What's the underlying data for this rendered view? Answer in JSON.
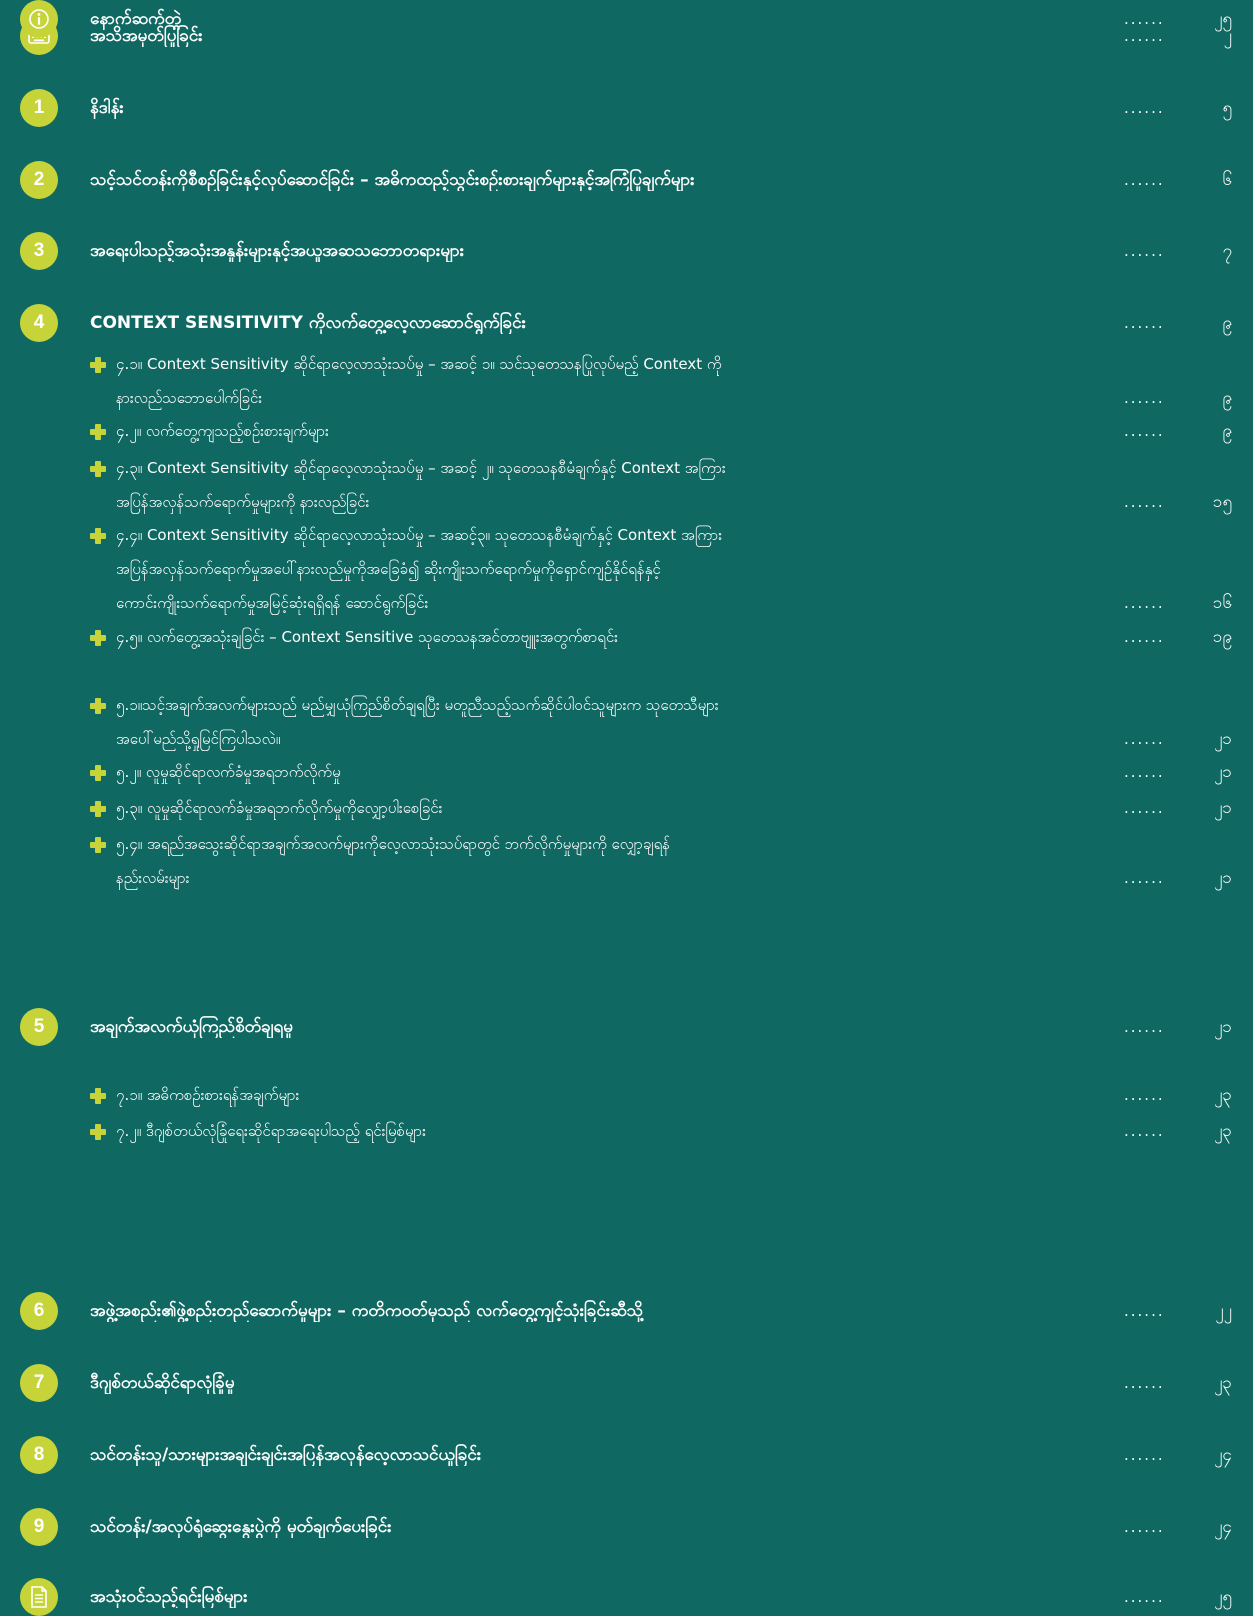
{
  "toc": {
    "entries": [
      {
        "badge": "keyboard-icon",
        "title": "အသိအမှတ်ပြုခြင်း",
        "dots": "......",
        "page": "၂",
        "subs": []
      },
      {
        "badge": "1",
        "title": "နိဒါန်း",
        "dots": "......",
        "page": "၅",
        "subs": []
      },
      {
        "badge": "2",
        "title": "သင့်သင်တန်းကိုစီစဉ်ခြင်းနှင့်လုပ်ဆောင်ခြင်း – အဓိကထည့်သွင်းစဉ်းစားချက်များနှင့်အကြံပြုချက်များ",
        "dots": "......",
        "page": "၆",
        "subs": []
      },
      {
        "badge": "3",
        "title": "အရေးပါသည့်အသုံးအနှုန်းများနှင့်အယူအဆသဘောတရားများ",
        "dots": "......",
        "page": "၇",
        "subs": []
      },
      {
        "badge": "4",
        "title": "CONTEXT SENSITIVITY ကိုလက်တွေ့လေ့လာဆောင်ရွက်ခြင်း",
        "dots": "......",
        "page": "၉",
        "subs": [
          {
            "lines": [
              "၄.၁။ Context Sensitivity ဆိုင်ရာလေ့လာသုံးသပ်မှု – အဆင့် ၁။ သင်သုတေသနပြုလုပ်မည့် Context ကို",
              "နားလည်သဘောပေါက်ခြင်း"
            ],
            "dots": "......",
            "page": "၉"
          },
          {
            "lines": [
              "၄.၂။ လက်တွေ့ကျသည့်စဉ်းစားချက်များ"
            ],
            "dots": "......",
            "page": "၉"
          },
          {
            "lines": [
              "၄.၃။ Context Sensitivity ဆိုင်ရာလေ့လာသုံးသပ်မှု – အဆင့် ၂။ သုတေသနစီမံချက်နှင့် Context အကြား",
              "အပြန်အလှန်သက်ရောက်မှုများကို နားလည်ခြင်း"
            ],
            "dots": "......",
            "page": "၁၅"
          },
          {
            "lines": [
              "၄.၄။ Context Sensitivity ဆိုင်ရာလေ့လာသုံးသပ်မှု – အဆင့်၃။ သုတေသနစီမံချက်နှင့် Context အကြား",
              "အပြန်အလှန်သက်ရောက်မှုအပေါ်နားလည်မှုကိုအခြေခံ၍ ဆိုးကျိုးသက်ရောက်မှုကိုရှောင်ကျဉ်နိုင်ရန်နှင့်",
              "ကောင်းကျိုးသက်ရောက်မှုအမြင့်ဆုံးရရှိရန် ဆောင်ရွက်ခြင်း"
            ],
            "dots": "......",
            "page": "၁၆"
          },
          {
            "lines": [
              "၄.၅။ လက်တွေ့အသုံးချခြင်း – Context Sensitive သုတေသနအင်တာဗျူးအတွက်စာရင်း"
            ],
            "dots": "......",
            "page": "၁၉"
          }
        ]
      },
      {
        "badge": "5",
        "title": "အချက်အလက်ယုံကြည်စိတ်ချရမှု",
        "dots": "......",
        "page": "၂၁",
        "subs": [
          {
            "lines": [
              "၅.၁။သင့်အချက်အလက်များသည် မည်မျှယုံကြည်စိတ်ချရပြီး မတူညီသည့်သက်ဆိုင်ပါဝင်သူများက သုတေသီများ",
              "အပေါ်မည်သို့ရှုမြင်ကြပါသလဲ။"
            ],
            "dots": "......",
            "page": "၂၁"
          },
          {
            "lines": [
              "၅.၂။ လူမှုဆိုင်ရာလက်ခံမှုအရဘက်လိုက်မှု"
            ],
            "dots": "......",
            "page": "၂၁"
          },
          {
            "lines": [
              "၅.၃။ လူမှုဆိုင်ရာလက်ခံမှုအရဘက်လိုက်မှုကိုလျှော့ပါးစေခြင်း"
            ],
            "dots": "......",
            "page": "၂၁"
          },
          {
            "lines": [
              "၅.၄။ အရည်အသွေးဆိုင်ရာအချက်အလက်များကိုလေ့လာသုံးသပ်ရာတွင် ဘက်လိုက်မှုများကို လျှော့ချရန်",
              "နည်းလမ်းများ"
            ],
            "dots": "......",
            "page": "၂၁"
          }
        ]
      },
      {
        "badge": "6",
        "title": "အဖွဲ့အစည်း၏ဖွဲ့စည်းတည်ဆောက်မှုများ – ကတိကဝတ်မှသည် လက်တွေ့ကျင့်သုံးခြင်းဆီသို့",
        "dots": "......",
        "page": "၂၂",
        "subs": []
      },
      {
        "badge": "7",
        "title": "ဒီဂျစ်တယ်ဆိုင်ရာလုံခြုံမှု",
        "dots": "......",
        "page": "၂၃",
        "subs": [
          {
            "lines": [
              "၇.၁။ အဓိကစဉ်းစားရန်အချက်များ"
            ],
            "dots": "......",
            "page": "၂၃"
          },
          {
            "lines": [
              "၇.၂။ ဒီဂျစ်တယ်လုံခြုံရေးဆိုင်ရာအရေးပါသည့် ရင်းမြစ်များ"
            ],
            "dots": "......",
            "page": "၂၃"
          }
        ]
      },
      {
        "badge": "8",
        "title": "သင်တန်းသူ/သားများအချင်းချင်းအပြန်အလှန်လေ့လာသင်ယူခြင်း",
        "dots": "......",
        "page": "၂၄",
        "subs": []
      },
      {
        "badge": "9",
        "title": "သင်တန်း/အလုပ်ရုံဆွေးနွေးပွဲကို မှတ်ချက်ပေးခြင်း",
        "dots": "......",
        "page": "၂၄",
        "subs": []
      },
      {
        "badge": "document-icon",
        "title": "အသုံးဝင်သည့်ရင်းမြစ်များ",
        "dots": "......",
        "page": "၂၅",
        "subs": []
      },
      {
        "badge": "info-icon",
        "title": "နောက်ဆက်တွဲ",
        "dots": "......",
        "page": "၂၅",
        "subs": []
      }
    ]
  }
}
